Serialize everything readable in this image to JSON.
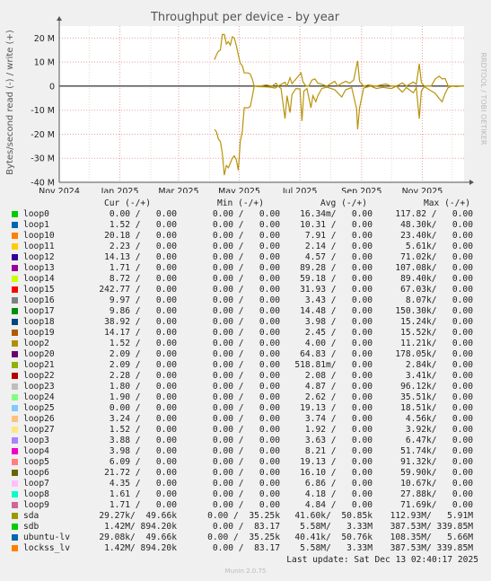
{
  "chart_data": {
    "type": "line",
    "title": "Throughput per device - by year",
    "ylabel": "Bytes/second read (-) / write (+)",
    "ylim": [
      -40000000,
      25000000
    ],
    "yticks": [
      {
        "v": 20000000,
        "label": "20 M"
      },
      {
        "v": 10000000,
        "label": "10 M"
      },
      {
        "v": 0,
        "label": "0"
      },
      {
        "v": -10000000,
        "label": "-10 M"
      },
      {
        "v": -20000000,
        "label": "-20 M"
      },
      {
        "v": -30000000,
        "label": "-30 M"
      },
      {
        "v": -40000000,
        "label": "-40 M"
      }
    ],
    "xlim": [
      "2024-11-01",
      "2025-12-13"
    ],
    "xticks": [
      {
        "v": "2024-11-01",
        "label": "Nov 2024"
      },
      {
        "v": "2025-01-01",
        "label": "Jan 2025"
      },
      {
        "v": "2025-03-01",
        "label": "Mar 2025"
      },
      {
        "v": "2025-05-01",
        "label": "May 2025"
      },
      {
        "v": "2025-07-01",
        "label": "Jul 2025"
      },
      {
        "v": "2025-09-01",
        "label": "Sep 2025"
      },
      {
        "v": "2025-11-01",
        "label": "Nov 2025"
      }
    ],
    "series": [
      {
        "name": "sda",
        "color": "#b8940c",
        "write": [
          [
            "2025-04-06",
            11000000
          ],
          [
            "2025-04-08",
            13000000
          ],
          [
            "2025-04-10",
            14500000
          ],
          [
            "2025-04-12",
            15000000
          ],
          [
            "2025-04-14",
            21500000
          ],
          [
            "2025-04-16",
            21500000
          ],
          [
            "2025-04-18",
            17500000
          ],
          [
            "2025-04-20",
            18500000
          ],
          [
            "2025-04-22",
            17000000
          ],
          [
            "2025-04-24",
            20500000
          ],
          [
            "2025-04-26",
            20000000
          ],
          [
            "2025-04-28",
            17000000
          ],
          [
            "2025-04-30",
            13000000
          ],
          [
            "2025-05-02",
            9500000
          ],
          [
            "2025-05-04",
            8500000
          ],
          [
            "2025-05-06",
            5500000
          ],
          [
            "2025-05-08",
            5500000
          ],
          [
            "2025-05-10",
            5500000
          ],
          [
            "2025-05-12",
            5000000
          ],
          [
            "2025-05-14",
            3000000
          ],
          [
            "2025-05-16",
            0
          ],
          [
            "2025-05-22",
            0
          ],
          [
            "2025-05-28",
            500000
          ],
          [
            "2025-06-03",
            0
          ],
          [
            "2025-06-07",
            1200000
          ],
          [
            "2025-06-09",
            0
          ],
          [
            "2025-06-16",
            1600000
          ],
          [
            "2025-06-18",
            0
          ],
          [
            "2025-06-21",
            3500000
          ],
          [
            "2025-06-23",
            1000000
          ],
          [
            "2025-07-02",
            5500000
          ],
          [
            "2025-07-04",
            1800000
          ],
          [
            "2025-07-07",
            0
          ],
          [
            "2025-07-10",
            0
          ],
          [
            "2025-07-13",
            2500000
          ],
          [
            "2025-07-16",
            3000000
          ],
          [
            "2025-07-19",
            1200000
          ],
          [
            "2025-07-23",
            800000
          ],
          [
            "2025-07-28",
            0
          ],
          [
            "2025-08-05",
            2000000
          ],
          [
            "2025-08-08",
            0
          ],
          [
            "2025-08-12",
            1200000
          ],
          [
            "2025-08-16",
            2000000
          ],
          [
            "2025-08-20",
            1200000
          ],
          [
            "2025-08-24",
            2500000
          ],
          [
            "2025-08-28",
            10500000
          ],
          [
            "2025-08-30",
            2000000
          ],
          [
            "2025-09-03",
            0
          ],
          [
            "2025-09-08",
            500000
          ],
          [
            "2025-09-15",
            0
          ],
          [
            "2025-09-25",
            900000
          ],
          [
            "2025-10-01",
            0
          ],
          [
            "2025-10-06",
            0
          ],
          [
            "2025-10-12",
            1300000
          ],
          [
            "2025-10-16",
            0
          ],
          [
            "2025-10-23",
            1700000
          ],
          [
            "2025-10-26",
            700000
          ],
          [
            "2025-10-29",
            9300000
          ],
          [
            "2025-10-31",
            1500000
          ],
          [
            "2025-11-03",
            0
          ],
          [
            "2025-11-10",
            0
          ],
          [
            "2025-11-14",
            3000000
          ],
          [
            "2025-11-18",
            4100000
          ],
          [
            "2025-11-21",
            3000000
          ],
          [
            "2025-11-24",
            3200000
          ],
          [
            "2025-11-27",
            0
          ],
          [
            "2025-12-01",
            0
          ],
          [
            "2025-12-05",
            0
          ],
          [
            "2025-12-10",
            0
          ],
          [
            "2025-12-13",
            0
          ]
        ],
        "read": [
          [
            "2025-04-06",
            -18000000
          ],
          [
            "2025-04-08",
            -19000000
          ],
          [
            "2025-04-10",
            -22000000
          ],
          [
            "2025-04-12",
            -23000000
          ],
          [
            "2025-04-14",
            -28000000
          ],
          [
            "2025-04-16",
            -37000000
          ],
          [
            "2025-04-18",
            -33000000
          ],
          [
            "2025-04-20",
            -34000000
          ],
          [
            "2025-04-22",
            -32000000
          ],
          [
            "2025-04-24",
            -30000000
          ],
          [
            "2025-04-26",
            -29000000
          ],
          [
            "2025-04-28",
            -30500000
          ],
          [
            "2025-04-30",
            -35000000
          ],
          [
            "2025-05-02",
            -23000000
          ],
          [
            "2025-05-04",
            -19000000
          ],
          [
            "2025-05-06",
            -9000000
          ],
          [
            "2025-05-08",
            -9000000
          ],
          [
            "2025-05-10",
            -9000000
          ],
          [
            "2025-05-12",
            -8500000
          ],
          [
            "2025-05-14",
            -4500000
          ],
          [
            "2025-05-16",
            0
          ],
          [
            "2025-05-20",
            -200000
          ],
          [
            "2025-05-26",
            -300000
          ],
          [
            "2025-06-01",
            -400000
          ],
          [
            "2025-06-06",
            -800000
          ],
          [
            "2025-06-09",
            0
          ],
          [
            "2025-06-12",
            -1000000
          ],
          [
            "2025-06-16",
            -13500000
          ],
          [
            "2025-06-18",
            -4000000
          ],
          [
            "2025-06-21",
            -11000000
          ],
          [
            "2025-06-23",
            -3500000
          ],
          [
            "2025-06-27",
            -1000000
          ],
          [
            "2025-07-01",
            -1200000
          ],
          [
            "2025-07-03",
            -14500000
          ],
          [
            "2025-07-05",
            -2000000
          ],
          [
            "2025-07-08",
            -1000000
          ],
          [
            "2025-07-12",
            -9000000
          ],
          [
            "2025-07-14",
            -4000000
          ],
          [
            "2025-07-17",
            -6500000
          ],
          [
            "2025-07-19",
            -4000000
          ],
          [
            "2025-07-23",
            -1000000
          ],
          [
            "2025-07-28",
            -400000
          ],
          [
            "2025-08-05",
            -1500000
          ],
          [
            "2025-08-12",
            -4500000
          ],
          [
            "2025-08-16",
            -1500000
          ],
          [
            "2025-08-22",
            -600000
          ],
          [
            "2025-08-27",
            -9500000
          ],
          [
            "2025-08-28",
            -18000000
          ],
          [
            "2025-08-30",
            -9000000
          ],
          [
            "2025-09-03",
            -800000
          ],
          [
            "2025-09-10",
            0
          ],
          [
            "2025-09-16",
            -1000000
          ],
          [
            "2025-09-22",
            -500000
          ],
          [
            "2025-10-01",
            -1000000
          ],
          [
            "2025-10-06",
            0
          ],
          [
            "2025-10-12",
            -2500000
          ],
          [
            "2025-10-16",
            -600000
          ],
          [
            "2025-10-23",
            -2800000
          ],
          [
            "2025-10-26",
            -600000
          ],
          [
            "2025-10-29",
            -13500000
          ],
          [
            "2025-10-31",
            -2000000
          ],
          [
            "2025-11-03",
            -200000
          ],
          [
            "2025-11-10",
            -2000000
          ],
          [
            "2025-11-14",
            -3000000
          ],
          [
            "2025-11-18",
            -5200000
          ],
          [
            "2025-11-21",
            -6500000
          ],
          [
            "2025-11-24",
            -3000000
          ],
          [
            "2025-11-27",
            -600000
          ],
          [
            "2025-12-01",
            0
          ],
          [
            "2025-12-05",
            -200000
          ],
          [
            "2025-12-10",
            0
          ],
          [
            "2025-12-13",
            0
          ]
        ]
      }
    ]
  },
  "side_label": "RRDTOOL / TOBI OETIKER",
  "legend": {
    "headers": {
      "cur": "Cur (-/+)",
      "min": "Min (-/+)",
      "avg": "Avg (-/+)",
      "max": "Max (-/+)"
    },
    "rows": [
      {
        "name": "loop0",
        "color": "#00cc00",
        "cur": "0.00 /   0.00",
        "min": "0.00 /   0.00",
        "avg": "16.34m/   0.00",
        "max": "117.82 /   0.00"
      },
      {
        "name": "loop1",
        "color": "#0066b3",
        "cur": "1.52 /   0.00",
        "min": "0.00 /   0.00",
        "avg": "10.31 /   0.00",
        "max": "48.30k/   0.00"
      },
      {
        "name": "loop10",
        "color": "#ff8000",
        "cur": "20.18 /   0.00",
        "min": "0.00 /   0.00",
        "avg": "7.91 /   0.00",
        "max": "23.40k/   0.00"
      },
      {
        "name": "loop11",
        "color": "#ffcc00",
        "cur": "2.23 /   0.00",
        "min": "0.00 /   0.00",
        "avg": "2.14 /   0.00",
        "max": "5.61k/   0.00"
      },
      {
        "name": "loop12",
        "color": "#330099",
        "cur": "14.13 /   0.00",
        "min": "0.00 /   0.00",
        "avg": "4.57 /   0.00",
        "max": "71.02k/   0.00"
      },
      {
        "name": "loop13",
        "color": "#990099",
        "cur": "1.71 /   0.00",
        "min": "0.00 /   0.00",
        "avg": "89.28 /   0.00",
        "max": "107.08k/   0.00"
      },
      {
        "name": "loop14",
        "color": "#ccff00",
        "cur": "8.72 /   0.00",
        "min": "0.00 /   0.00",
        "avg": "59.18 /   0.00",
        "max": "89.40k/   0.00"
      },
      {
        "name": "loop15",
        "color": "#ff0000",
        "cur": "242.77 /   0.00",
        "min": "0.00 /   0.00",
        "avg": "31.93 /   0.00",
        "max": "67.03k/   0.00"
      },
      {
        "name": "loop16",
        "color": "#808080",
        "cur": "9.97 /   0.00",
        "min": "0.00 /   0.00",
        "avg": "3.43 /   0.00",
        "max": "8.07k/   0.00"
      },
      {
        "name": "loop17",
        "color": "#008f00",
        "cur": "9.86 /   0.00",
        "min": "0.00 /   0.00",
        "avg": "14.48 /   0.00",
        "max": "150.30k/   0.00"
      },
      {
        "name": "loop18",
        "color": "#00487d",
        "cur": "38.92 /   0.00",
        "min": "0.00 /   0.00",
        "avg": "3.98 /   0.00",
        "max": "15.24k/   0.00"
      },
      {
        "name": "loop19",
        "color": "#b35a00",
        "cur": "14.17 /   0.00",
        "min": "0.00 /   0.00",
        "avg": "2.45 /   0.00",
        "max": "15.52k/   0.00"
      },
      {
        "name": "loop2",
        "color": "#b38f00",
        "cur": "1.52 /   0.00",
        "min": "0.00 /   0.00",
        "avg": "4.00 /   0.00",
        "max": "11.21k/   0.00"
      },
      {
        "name": "loop20",
        "color": "#6b006b",
        "cur": "2.09 /   0.00",
        "min": "0.00 /   0.00",
        "avg": "64.83 /   0.00",
        "max": "178.05k/   0.00"
      },
      {
        "name": "loop21",
        "color": "#8fb300",
        "cur": "2.09 /   0.00",
        "min": "0.00 /   0.00",
        "avg": "518.81m/   0.00",
        "max": "2.84k/   0.00"
      },
      {
        "name": "loop22",
        "color": "#b30000",
        "cur": "2.28 /   0.00",
        "min": "0.00 /   0.00",
        "avg": "2.08 /   0.00",
        "max": "3.41k/   0.00"
      },
      {
        "name": "loop23",
        "color": "#bebebe",
        "cur": "1.80 /   0.00",
        "min": "0.00 /   0.00",
        "avg": "4.87 /   0.00",
        "max": "96.12k/   0.00"
      },
      {
        "name": "loop24",
        "color": "#80ff80",
        "cur": "1.90 /   0.00",
        "min": "0.00 /   0.00",
        "avg": "2.62 /   0.00",
        "max": "35.51k/   0.00"
      },
      {
        "name": "loop25",
        "color": "#80c9ff",
        "cur": "0.00 /   0.00",
        "min": "0.00 /   0.00",
        "avg": "19.13 /   0.00",
        "max": "18.51k/   0.00"
      },
      {
        "name": "loop26",
        "color": "#ffc080",
        "cur": "3.24 /   0.00",
        "min": "0.00 /   0.00",
        "avg": "3.74 /   0.00",
        "max": "4.56k/   0.00"
      },
      {
        "name": "loop27",
        "color": "#ffe680",
        "cur": "1.52 /   0.00",
        "min": "0.00 /   0.00",
        "avg": "1.92 /   0.00",
        "max": "3.92k/   0.00"
      },
      {
        "name": "loop3",
        "color": "#aa80ff",
        "cur": "3.88 /   0.00",
        "min": "0.00 /   0.00",
        "avg": "3.63 /   0.00",
        "max": "6.47k/   0.00"
      },
      {
        "name": "loop4",
        "color": "#ee00cc",
        "cur": "3.98 /   0.00",
        "min": "0.00 /   0.00",
        "avg": "8.21 /   0.00",
        "max": "51.74k/   0.00"
      },
      {
        "name": "loop5",
        "color": "#ff8080",
        "cur": "6.09 /   0.00",
        "min": "0.00 /   0.00",
        "avg": "19.13 /   0.00",
        "max": "91.32k/   0.00"
      },
      {
        "name": "loop6",
        "color": "#666600",
        "cur": "21.72 /   0.00",
        "min": "0.00 /   0.00",
        "avg": "16.10 /   0.00",
        "max": "59.90k/   0.00"
      },
      {
        "name": "loop7",
        "color": "#ffbfff",
        "cur": "4.35 /   0.00",
        "min": "0.00 /   0.00",
        "avg": "6.86 /   0.00",
        "max": "10.67k/   0.00"
      },
      {
        "name": "loop8",
        "color": "#00ffcc",
        "cur": "1.61 /   0.00",
        "min": "0.00 /   0.00",
        "avg": "4.18 /   0.00",
        "max": "27.88k/   0.00"
      },
      {
        "name": "loop9",
        "color": "#cc6699",
        "cur": "1.71 /   0.00",
        "min": "0.00 /   0.00",
        "avg": "4.84 /   0.00",
        "max": "71.69k/   0.00"
      },
      {
        "name": "sda",
        "color": "#999900",
        "cur": "29.27k/  49.66k",
        "min": "0.00 /  35.25k",
        "avg": "41.60k/  50.85k",
        "max": "112.93M/   5.91M"
      },
      {
        "name": "sdb",
        "color": "#00cc00",
        "cur": "1.42M/ 894.20k",
        "min": "0.00 /  83.17",
        "avg": "5.58M/   3.33M",
        "max": "387.53M/ 339.85M"
      },
      {
        "name": "ubuntu-lv",
        "color": "#0066b3",
        "cur": "29.08k/  49.66k",
        "min": "0.00 /  35.25k",
        "avg": "40.41k/  50.76k",
        "max": "108.35M/   5.66M"
      },
      {
        "name": "lockss_lv",
        "color": "#ff8000",
        "cur": "1.42M/ 894.20k",
        "min": "0.00 /  83.17",
        "avg": "5.58M/   3.33M",
        "max": "387.53M/ 339.85M"
      }
    ]
  },
  "last_update": "Last update: Sat Dec 13 02:40:17 2025",
  "footer": "Munin 2.0.75"
}
